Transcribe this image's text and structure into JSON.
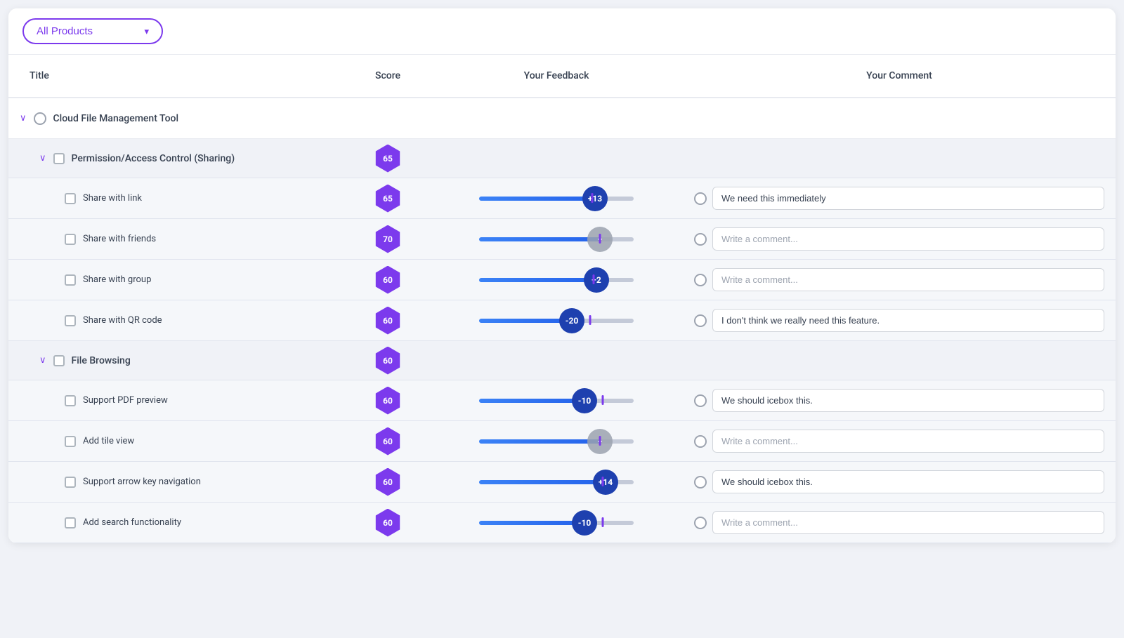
{
  "dropdown": {
    "label": "All Products",
    "arrow": "▾"
  },
  "columns": {
    "title": "Title",
    "score": "Score",
    "feedback": "Your Feedback",
    "comment": "Your Comment"
  },
  "groups": [
    {
      "name": "Cloud File Management Tool",
      "subgroups": [
        {
          "name": "Permission/Access Control (Sharing)",
          "score": "65",
          "items": [
            {
              "title": "Share with link",
              "score": "65",
              "sliderFill": 75,
              "thumbType": "blue",
              "thumbLabel": "+13",
              "markerPos": 73,
              "comment": "We need this immediately",
              "commentPlaceholder": ""
            },
            {
              "title": "Share with friends",
              "score": "70",
              "sliderFill": 78,
              "thumbType": "gray",
              "thumbLabel": "+",
              "markerPos": 78,
              "comment": "",
              "commentPlaceholder": "Write a comment..."
            },
            {
              "title": "Share with group",
              "score": "60",
              "sliderFill": 76,
              "thumbType": "blue",
              "thumbLabel": "+2",
              "markerPos": 74,
              "comment": "",
              "commentPlaceholder": "Write a comment..."
            },
            {
              "title": "Share with QR code",
              "score": "60",
              "sliderFill": 60,
              "thumbType": "blue",
              "thumbLabel": "-20",
              "markerPos": 72,
              "comment": "I don't think we really need this feature.",
              "commentPlaceholder": ""
            }
          ]
        },
        {
          "name": "File Browsing",
          "score": "60",
          "items": [
            {
              "title": "Support PDF preview",
              "score": "60",
              "sliderFill": 68,
              "thumbType": "blue",
              "thumbLabel": "-10",
              "markerPos": 80,
              "comment": "We should icebox this.",
              "commentPlaceholder": ""
            },
            {
              "title": "Add tile view",
              "score": "60",
              "sliderFill": 78,
              "thumbType": "gray",
              "thumbLabel": "+",
              "markerPos": 78,
              "comment": "",
              "commentPlaceholder": "Write a comment..."
            },
            {
              "title": "Support arrow key navigation",
              "score": "60",
              "sliderFill": 82,
              "thumbType": "blue",
              "thumbLabel": "+14",
              "markerPos": 80,
              "comment": "We should icebox this.",
              "commentPlaceholder": ""
            },
            {
              "title": "Add search functionality",
              "score": "60",
              "sliderFill": 68,
              "thumbType": "blue",
              "thumbLabel": "-10",
              "markerPos": 80,
              "comment": "",
              "commentPlaceholder": "Write a comment..."
            }
          ]
        }
      ]
    }
  ]
}
